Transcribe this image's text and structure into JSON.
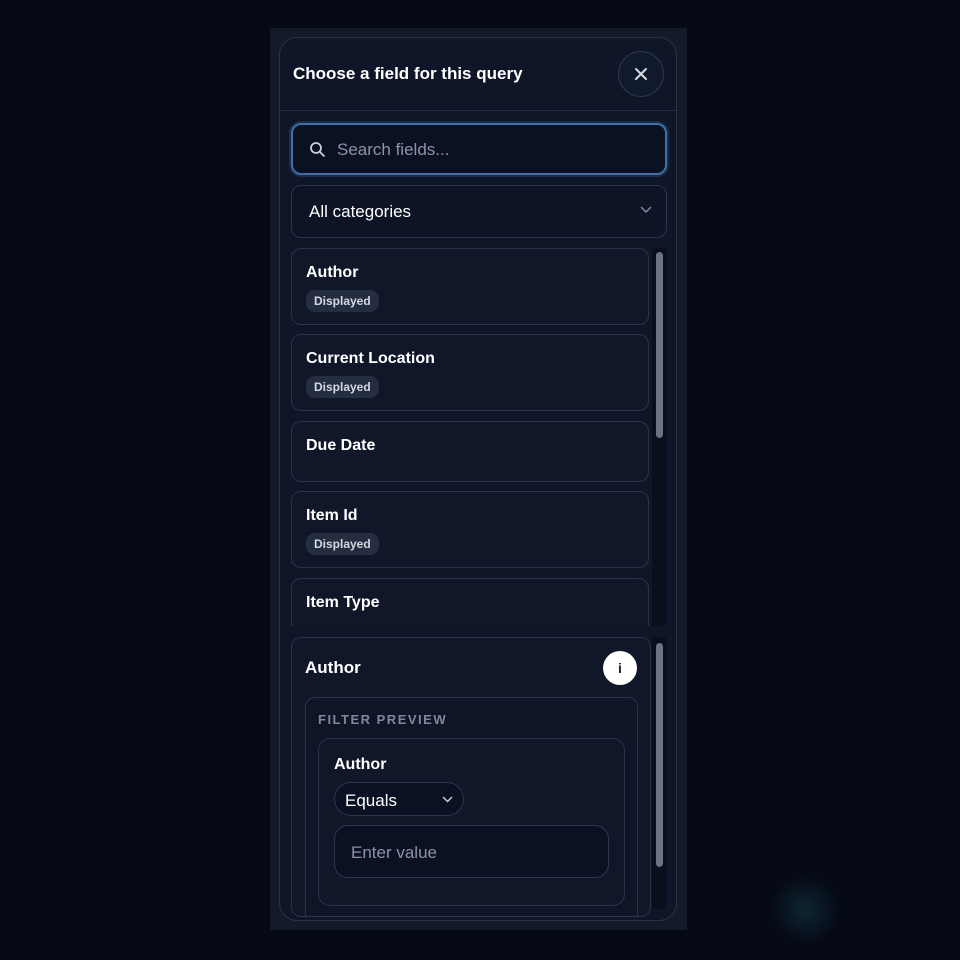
{
  "dialog": {
    "title": "Choose a field for this query",
    "close_icon": "close-icon"
  },
  "search": {
    "placeholder": "Search fields...",
    "value": "",
    "icon": "search-icon"
  },
  "category": {
    "selected": "All categories",
    "icon": "chevron-down-icon"
  },
  "fields": [
    {
      "label": "Author",
      "badge": "Displayed"
    },
    {
      "label": "Current Location",
      "badge": "Displayed"
    },
    {
      "label": "Due Date",
      "badge": ""
    },
    {
      "label": "Item Id",
      "badge": "Displayed"
    },
    {
      "label": "Item Type",
      "badge": ""
    }
  ],
  "detail": {
    "field_name": "Author",
    "info_icon_text": "i",
    "preview_label": "FILTER PREVIEW",
    "filter": {
      "field_name": "Author",
      "operator": "Equals",
      "value_placeholder": "Enter value",
      "value": ""
    }
  },
  "colors": {
    "accent": "#3f6fa8",
    "background": "#050a16",
    "panel": "#0e1628"
  }
}
